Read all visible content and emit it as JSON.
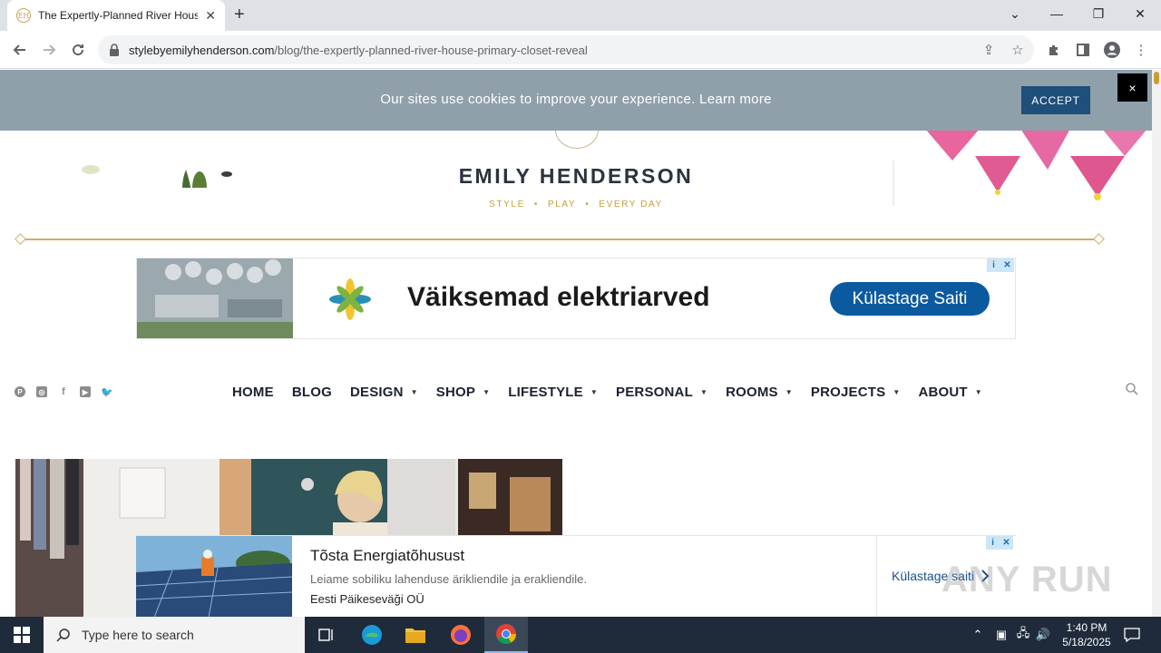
{
  "browser": {
    "tab_title": "The Expertly-Planned River House",
    "new_tab_label": "+",
    "url_domain": "stylebyemilyhenderson.com",
    "url_path": "/blog/the-expertly-planned-river-house-primary-closet-reveal"
  },
  "cookie_bar": {
    "message": "Our sites use cookies to improve your experience. Learn more",
    "accept_label": "ACCEPT",
    "close_label": "×"
  },
  "site": {
    "brand": "EMILY HENDERSON",
    "tagline": [
      "STYLE",
      "PLAY",
      "EVERY DAY"
    ],
    "tagline_separator": "•"
  },
  "ad_top": {
    "headline": "Väiksemad elektriarved",
    "cta": "Külastage Saiti",
    "info": "i",
    "close": "✕"
  },
  "nav": {
    "items": [
      {
        "label": "HOME",
        "has_dropdown": false
      },
      {
        "label": "BLOG",
        "has_dropdown": false
      },
      {
        "label": "DESIGN",
        "has_dropdown": true
      },
      {
        "label": "SHOP",
        "has_dropdown": true
      },
      {
        "label": "LIFESTYLE",
        "has_dropdown": true
      },
      {
        "label": "PERSONAL",
        "has_dropdown": true
      },
      {
        "label": "ROOMS",
        "has_dropdown": true
      },
      {
        "label": "PROJECTS",
        "has_dropdown": true
      },
      {
        "label": "ABOUT",
        "has_dropdown": true
      }
    ],
    "caret": "▼",
    "social": [
      "pinterest-icon",
      "instagram-icon",
      "facebook-icon",
      "youtube-icon",
      "twitter-icon"
    ]
  },
  "ad_bottom": {
    "title": "Tõsta Energiatõhusust",
    "description": "Leiame sobiliku lahenduse ärikliendile ja erakliendile.",
    "advertiser": "Eesti Päikeseväği OÜ",
    "cta": "Külastage saiti",
    "info": "i",
    "close": "✕"
  },
  "watermark": "ANY RUN",
  "taskbar": {
    "search_placeholder": "Type here to search",
    "time": "1:40 PM",
    "date": "5/18/2025"
  },
  "colors": {
    "accent_gold": "#c79e34",
    "cookie_bg": "#8fa0ab",
    "accept_bg": "#1f4f7a",
    "ad_cta_bg": "#0b5aa0",
    "brand_text": "#2b3340"
  }
}
